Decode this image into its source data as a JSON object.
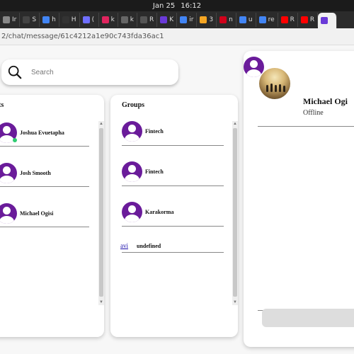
{
  "os": {
    "date": "Jan 25",
    "time": "16:12"
  },
  "browser": {
    "tabs": [
      {
        "label": "Ir",
        "color": "#888"
      },
      {
        "label": "S",
        "color": "#444"
      },
      {
        "label": "h",
        "color": "#4285f4"
      },
      {
        "label": "H",
        "color": "#333"
      },
      {
        "label": "(",
        "color": "#6f6fff"
      },
      {
        "label": "k",
        "color": "#e0245e"
      },
      {
        "label": "k",
        "color": "#666"
      },
      {
        "label": "R",
        "color": "#555"
      },
      {
        "label": "K",
        "color": "#6a3ad8"
      },
      {
        "label": "ir",
        "color": "#4285f4"
      },
      {
        "label": "3",
        "color": "#f5a623"
      },
      {
        "label": "n",
        "color": "#d0021b"
      },
      {
        "label": "u",
        "color": "#4285f4"
      },
      {
        "label": "re",
        "color": "#4285f4"
      },
      {
        "label": "R",
        "color": "#ff0000"
      },
      {
        "label": "R",
        "color": "#ff0000"
      },
      {
        "label": "",
        "color": "#6a3ad8"
      }
    ],
    "url": "2/chat/message/61c4212a1e90c743fda36ac1"
  },
  "search": {
    "placeholder": "Search"
  },
  "contacts": {
    "title": "ts",
    "items": [
      {
        "name": "Joshua Evuetapha",
        "online": true
      },
      {
        "name": "Josh Smooth",
        "online": false
      },
      {
        "name": "Michael Ogisi",
        "online": false
      }
    ]
  },
  "groups": {
    "title": "Groups",
    "items": [
      {
        "name": "Fintech"
      },
      {
        "name": "Fintech"
      },
      {
        "name": "Karakorma"
      }
    ],
    "broken": {
      "alt": "avi",
      "name": "undefined"
    }
  },
  "chat": {
    "name": "Michael Ogi",
    "status": "Offline"
  },
  "colors": {
    "avatar": "#6a1b9a",
    "online": "#2ecc71"
  }
}
